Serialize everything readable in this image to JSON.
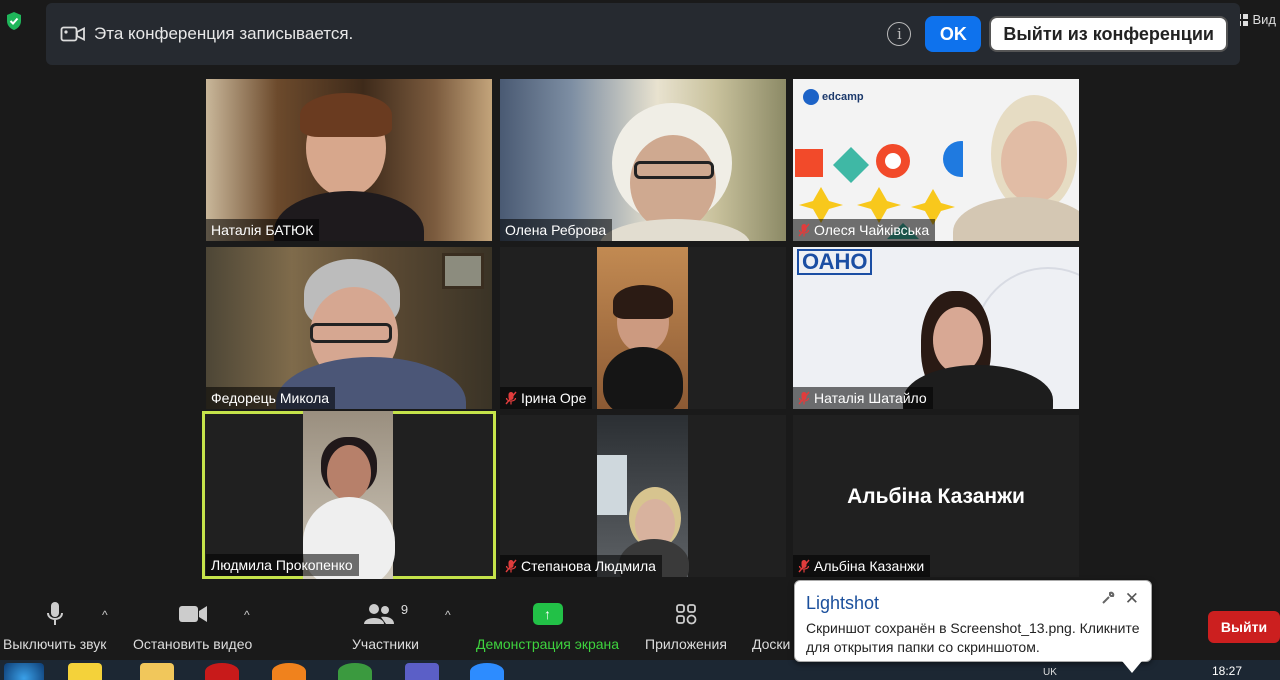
{
  "top": {
    "view_label": "Вид"
  },
  "recording_banner": {
    "text": "Эта конференция записывается.",
    "ok_label": "OK",
    "leave_label": "Выйти из конференции"
  },
  "participants": [
    {
      "name": "Наталія БАТЮК",
      "muted": false
    },
    {
      "name": "Олена Реброва",
      "muted": false
    },
    {
      "name": "Олеся Чайківська",
      "muted": true
    },
    {
      "name": "Федорець Микола",
      "muted": false
    },
    {
      "name": "Ірина Оре",
      "muted": true
    },
    {
      "name": "Наталія Шатайло",
      "muted": true
    },
    {
      "name": "Людмила Прокопенко",
      "muted": false,
      "active_speaker": true
    },
    {
      "name": "Степанова Людмила",
      "muted": true
    },
    {
      "name": "Альбіна Казанжи",
      "muted": true,
      "video_off": true
    }
  ],
  "tile_logos": {
    "edcamp": "edcamp",
    "oano": "ОАНО"
  },
  "toolbar": {
    "mute_label": "Выключить звук",
    "video_label": "Остановить видео",
    "participants_label": "Участники",
    "participants_count": "9",
    "share_label": "Демонстрация экрана",
    "apps_label": "Приложения",
    "board_label": "Доски",
    "exit_label": "Выйти"
  },
  "lightshot": {
    "title": "Lightshot",
    "message": "Скриншот сохранён в Screenshot_13.png. Кликните для открытия папки со скриншотом."
  },
  "taskbar": {
    "lang": "UK",
    "time": "18:27"
  },
  "colors": {
    "accent_blue": "#0e72ed",
    "share_green": "#22c147",
    "exit_red": "#cc1f1f",
    "active_speaker": "#c5e34a",
    "mute_red": "#e03c3c"
  }
}
